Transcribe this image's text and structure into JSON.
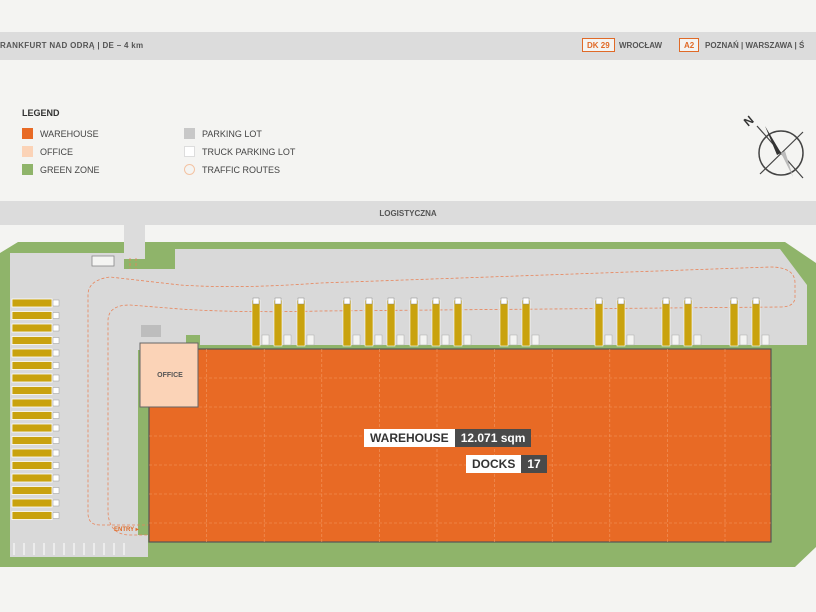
{
  "topbar": {
    "left_text": "RANKFURT NAD ODRĄ  |  DE – 4 km",
    "roads": [
      {
        "badge": "DK 29",
        "text": "WROCŁAW"
      },
      {
        "badge": "A2",
        "text": "POZNAŃ | WARSZAWA  |  Ś"
      }
    ]
  },
  "legend": {
    "title": "LEGEND",
    "items": [
      {
        "label": "WAREHOUSE",
        "color": "#e86a25"
      },
      {
        "label": "OFFICE",
        "color": "#fbd3b7"
      },
      {
        "label": "GREEN ZONE",
        "color": "#8fb46a"
      },
      {
        "label": "PARKING LOT",
        "color": "#c8c8c8"
      },
      {
        "label": "TRUCK PARKING LOT",
        "color": "#ffffff"
      },
      {
        "label": "TRAFFIC ROUTES",
        "color": "#f3c3a3"
      }
    ]
  },
  "compass": {
    "north": "N"
  },
  "street": {
    "name": "LOGISTYCZNA"
  },
  "site": {
    "office_label": "OFFICE",
    "entry_label": "ENTRY",
    "warehouse_label": "WAREHOUSE",
    "warehouse_area": "12.071 sqm",
    "docks_label": "DOCKS",
    "docks_count": "17"
  },
  "colors": {
    "warehouse": "#e86a25",
    "green": "#8fb46a",
    "lot": "#d9d9d9",
    "dock": "#c9a20e",
    "route": "#e8845a"
  }
}
